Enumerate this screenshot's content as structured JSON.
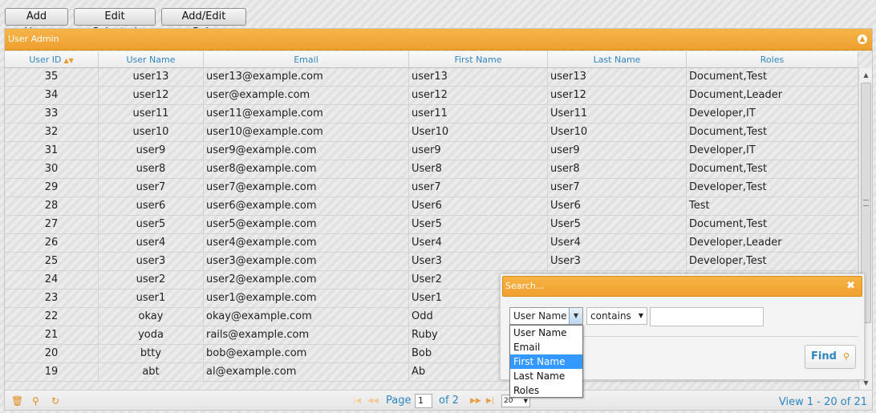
{
  "toolbar": {
    "add_user": "Add User",
    "edit_selected": "Edit Selected",
    "add_edit_role": "Add/Edit Role"
  },
  "grid": {
    "caption": "User Admin",
    "columns": [
      "User ID",
      "User Name",
      "Email",
      "First Name",
      "Last Name",
      "Roles"
    ],
    "rows": [
      [
        "35",
        "user13",
        "user13@example.com",
        "user13",
        "user13",
        "Document,Test"
      ],
      [
        "34",
        "user12",
        "user@example.com",
        "user12",
        "user12",
        "Document,Leader"
      ],
      [
        "33",
        "user11",
        "user11@example.com",
        "user11",
        "User11",
        "Developer,IT"
      ],
      [
        "32",
        "user10",
        "user10@example.com",
        "User10",
        "User10",
        "Document,Test"
      ],
      [
        "31",
        "user9",
        "user9@example.com",
        "user9",
        "user9",
        "Developer,IT"
      ],
      [
        "30",
        "user8",
        "user8@example.com",
        "User8",
        "user8",
        "Document,Test"
      ],
      [
        "29",
        "user7",
        "user7@example.com",
        "user7",
        "user7",
        "Developer,Test"
      ],
      [
        "28",
        "user6",
        "user6@example.com",
        "User6",
        "User6",
        "Test"
      ],
      [
        "27",
        "user5",
        "user5@example.com",
        "User5",
        "User5",
        "Document,Test"
      ],
      [
        "26",
        "user4",
        "user4@example.com",
        "User4",
        "User4",
        "Developer,Leader"
      ],
      [
        "25",
        "user3",
        "user3@example.com",
        "User3",
        "User3",
        "Developer,Test"
      ],
      [
        "24",
        "user2",
        "user2@example.com",
        "User2",
        "",
        ""
      ],
      [
        "23",
        "user1",
        "user1@example.com",
        "User1",
        "",
        ""
      ],
      [
        "22",
        "okay",
        "okay@example.com",
        "Odd",
        "",
        ""
      ],
      [
        "21",
        "yoda",
        "rails@example.com",
        "Ruby",
        "",
        ""
      ],
      [
        "20",
        "btty",
        "bob@example.com",
        "Bob",
        "",
        ""
      ],
      [
        "19",
        "abt",
        "al@example.com",
        "Ab",
        "",
        ""
      ]
    ]
  },
  "pager": {
    "page_label": "Page",
    "page_value": "1",
    "of_label": "of 2",
    "rows_per_page": "20",
    "view_text": "View 1 - 20 of 21"
  },
  "search": {
    "title": "Search...",
    "field_selected": "User Name",
    "operator": "contains",
    "value": "",
    "find_label": "Find",
    "field_options": [
      "User Name",
      "Email",
      "First Name",
      "Last Name",
      "Roles"
    ],
    "highlighted_option": "First Name"
  },
  "colors": {
    "accent": "#f0a030",
    "link_blue": "#2f86c0",
    "highlight": "#3399ff"
  },
  "icons": [
    "sort-desc-icon",
    "collapse-icon",
    "trash-icon",
    "search-icon",
    "refresh-icon",
    "first-page-icon",
    "prev-page-icon",
    "next-page-icon",
    "last-page-icon",
    "close-icon",
    "chevron-down-icon"
  ]
}
